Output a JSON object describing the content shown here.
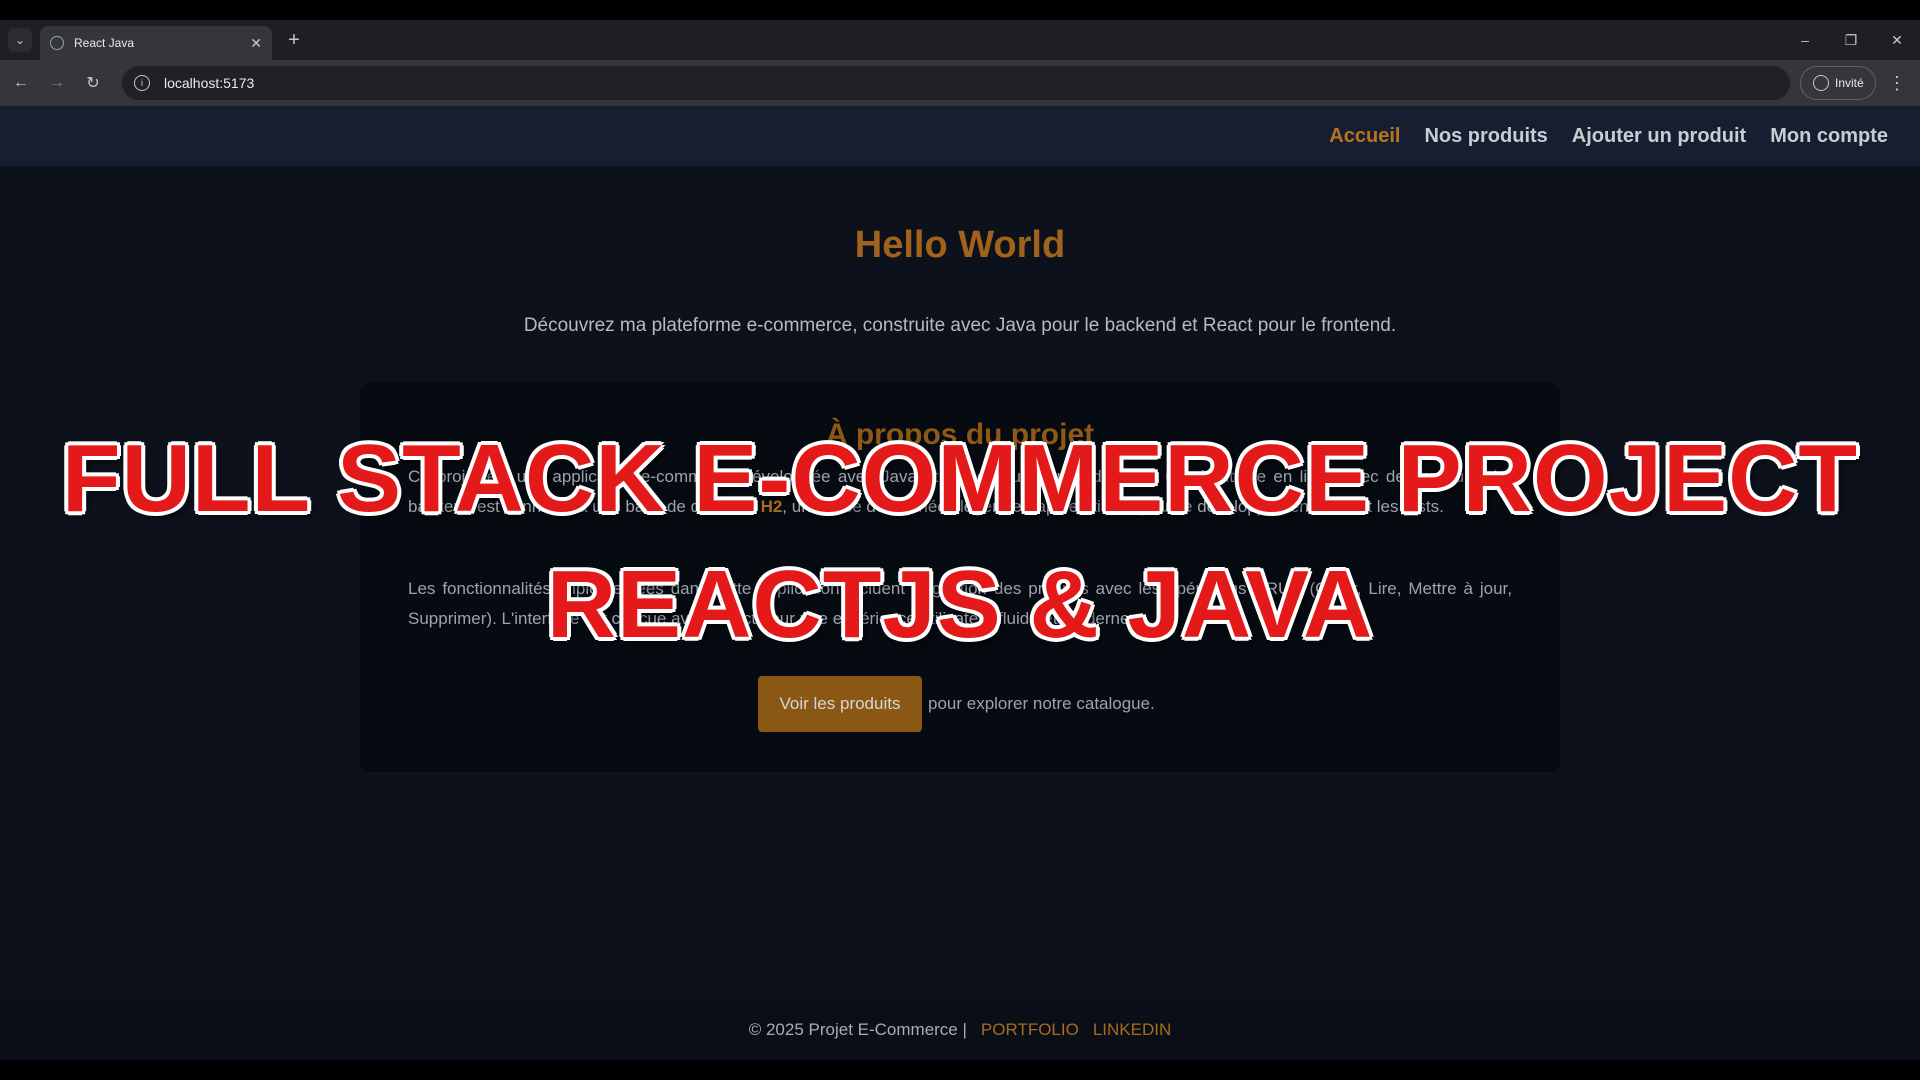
{
  "browser": {
    "tab_title": "React Java",
    "url": "localhost:5173",
    "profile_label": "Invité",
    "icons": [
      "tab-search-icon",
      "globe-icon",
      "close-icon",
      "plus-icon",
      "minimize-icon",
      "restore-icon",
      "close-window-icon",
      "back-arrow-icon",
      "forward-arrow-icon",
      "reload-icon",
      "info-icon",
      "profile-icon",
      "kebab-menu-icon"
    ]
  },
  "nav": {
    "items": [
      {
        "label": "Accueil"
      },
      {
        "label": "Nos produits"
      },
      {
        "label": "Ajouter un produit"
      },
      {
        "label": "Mon compte"
      }
    ],
    "active_color": "#b8741f"
  },
  "hero": {
    "title": "Hello World",
    "subtitle": "Découvrez ma plateforme e-commerce, construite avec Java pour le backend et React pour le frontend."
  },
  "about": {
    "title": "À propos du projet",
    "p1_start": "Ce projet est une application e-commerce développée avec Java et React, qui permet de gérer une",
    "p1_mid": "boutique en ligne avec des produits. Le backend est connecté à une base de données ",
    "p1_highlight": "H2",
    "p1_end": ", une base de données légère et rapide utilisée pour le développement local et les tests.",
    "p2": "Les fonctionnalités implémentées dans cette application incluent la gestion des produits avec les opérations CRUD (Créer, Lire, Mettre à jour, Supprimer). L'interface est conçue avec React pour une expérience utilisateur fluide et moderne.",
    "cta_button": "Voir les produits",
    "cta_text": "pour explorer notre catalogue."
  },
  "footer": {
    "copyright": "© 2025 Projet E-Commerce |",
    "links": [
      "PORTFOLIO",
      "LINKEDIN"
    ]
  },
  "overlay": {
    "line1": "FULL STACK E-COMMERCE PROJECT",
    "line2": "REACTJS & JAVA",
    "color": "#e41a1a"
  }
}
